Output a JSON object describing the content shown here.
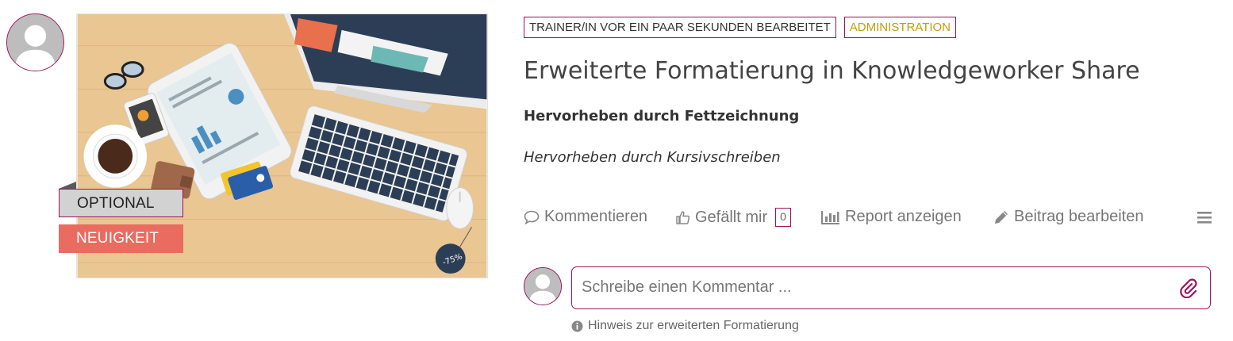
{
  "post": {
    "author_avatar_icon": "user-avatar-icon",
    "image_icon": "desk-workspace-illustration",
    "tags": {
      "optional": "OPTIONAL",
      "news": "NEUIGKEIT"
    },
    "badges": {
      "trainer": "TRAINER/IN VOR EIN PAAR SEKUNDEN BEARBEITET",
      "admin": "ADMINISTRATION"
    },
    "title": "Erweiterte Formatierung in Knowledgeworker Share",
    "bold_text": "Hervorheben durch Fettzeichnung",
    "italic_text": "Hervorheben durch Kursivschreiben"
  },
  "actions": {
    "comment_label": "Kommentieren",
    "like_label": "Gefällt mir",
    "like_count": "0",
    "report_label": "Report anzeigen",
    "edit_label": "Beitrag bearbeiten",
    "menu_icon": "hamburger-menu-icon"
  },
  "comment": {
    "placeholder": "Schreibe einen Kommentar ...",
    "value": "",
    "attach_icon": "paperclip-icon",
    "hint": "Hinweis zur erweiterten Formatierung"
  },
  "colors": {
    "accent": "#a0105a",
    "admin_badge_text": "#c59a0c",
    "news_tag": "#ea6b60",
    "optional_tag": "#d2d2d2"
  }
}
